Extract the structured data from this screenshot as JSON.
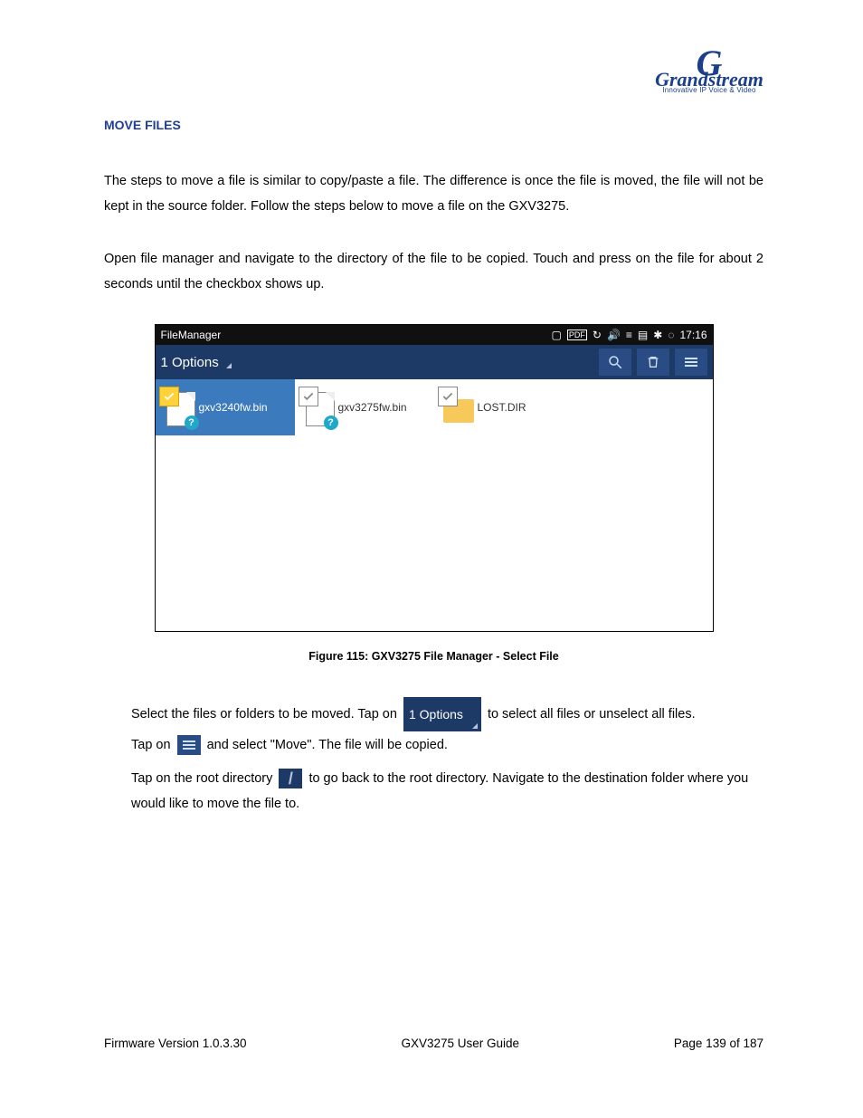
{
  "header": {
    "logo_text": "Grandstream",
    "logo_tagline": "Innovative IP Voice & Video"
  },
  "section": {
    "title": "MOVE FILES",
    "intro": "The steps to move a file is similar to copy/paste a file. The difference is once the file is moved, the file will not be kept in the source folder. Follow the steps below to move a file on the GXV3275.",
    "step1": "Open file manager and navigate to the directory of the file to be copied. Touch and press on the file for about 2 seconds until the checkbox shows up."
  },
  "screenshot": {
    "app_title": "FileManager",
    "status_time": "17:16",
    "options_label": "1 Options",
    "files": [
      {
        "name": "gxv3240fw.bin",
        "selected": true,
        "kind": "doc"
      },
      {
        "name": "gxv3275fw.bin",
        "selected": false,
        "kind": "doc"
      },
      {
        "name": "LOST.DIR",
        "selected": false,
        "kind": "folder"
      }
    ],
    "caption": "Figure 115: GXV3275 File Manager - Select File"
  },
  "steps_after": {
    "s2a": "Select the files or folders to be moved. Tap on",
    "s2b": "to select all files or unselect all files.",
    "options_chip": "1 Options",
    "s3a": "Tap on",
    "s3b": "and select \"Move\". The file will be copied.",
    "s4a": "Tap on the root directory",
    "s4b": "to go back to the root directory. Navigate to the destination folder where you would like to move the file to.",
    "root_glyph": "/"
  },
  "footer": {
    "left": "Firmware Version 1.0.3.30",
    "center": "GXV3275 User Guide",
    "right": "Page 139 of 187"
  }
}
